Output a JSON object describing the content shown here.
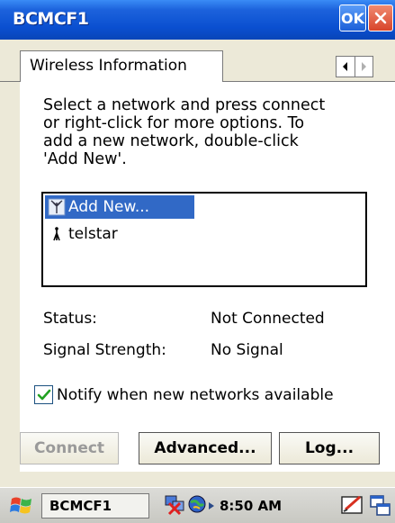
{
  "window": {
    "title": "BCMCF1",
    "ok_label": "OK"
  },
  "tabs": [
    {
      "label": "Wireless Information"
    }
  ],
  "instructions": [
    "Select a network and press connect",
    "or right-click for more options.  To",
    "add a new network, double-click",
    "'Add New'."
  ],
  "networks": [
    {
      "label": "Add New...",
      "icon": "add-network-icon",
      "selected": true
    },
    {
      "label": "telstar",
      "icon": "wireless-tower-icon",
      "selected": false
    }
  ],
  "status": {
    "status_label": "Status:",
    "status_value": "Not Connected",
    "signal_label": "Signal Strength:",
    "signal_value": "No Signal"
  },
  "notify": {
    "label": "Notify when new networks available",
    "checked": true
  },
  "buttons": {
    "connect": "Connect",
    "advanced": "Advanced...",
    "log": "Log..."
  },
  "taskbar": {
    "task_label": "BCMCF1",
    "clock": "8:50 AM"
  },
  "colors": {
    "title_bar": "#0a4fd0",
    "selection": "#3169c6",
    "panel": "#ffffff",
    "chrome": "#ece9d8",
    "close_button": "#d8442a"
  }
}
